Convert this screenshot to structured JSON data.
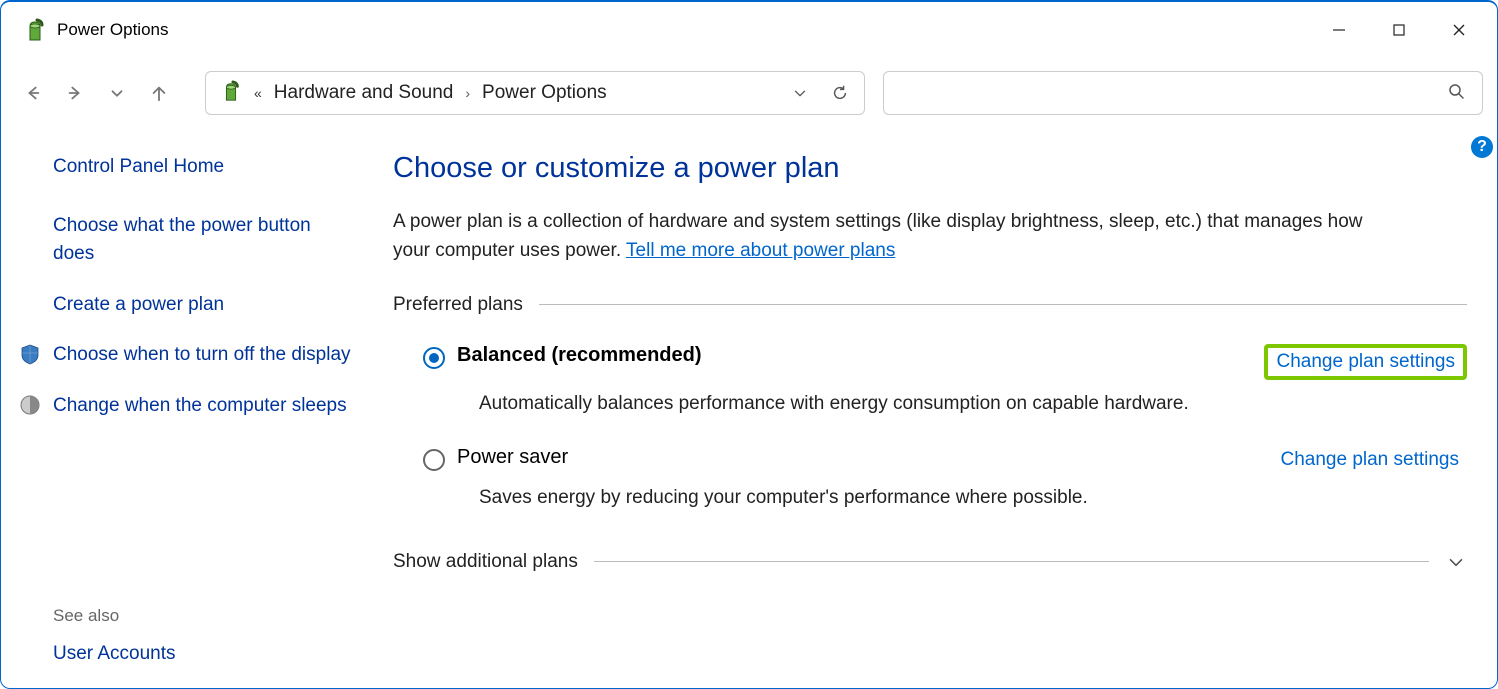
{
  "window": {
    "title": "Power Options"
  },
  "breadcrumb": {
    "item1": "Hardware and Sound",
    "item2": "Power Options"
  },
  "sidebar": {
    "home": "Control Panel Home",
    "tasks": [
      {
        "label": "Choose what the power button does"
      },
      {
        "label": "Create a power plan"
      },
      {
        "label": "Choose when to turn off the display"
      },
      {
        "label": "Change when the computer sleeps"
      }
    ],
    "see_also_label": "See also",
    "see_also_items": [
      {
        "label": "User Accounts"
      }
    ]
  },
  "main": {
    "heading": "Choose or customize a power plan",
    "description_pre": "A power plan is a collection of hardware and system settings (like display brightness, sleep, etc.) that manages how your computer uses power. ",
    "description_link": "Tell me more about power plans",
    "preferred_label": "Preferred plans",
    "additional_label": "Show additional plans",
    "plans": [
      {
        "name": "Balanced (recommended)",
        "desc": "Automatically balances performance with energy consumption on capable hardware.",
        "change": "Change plan settings"
      },
      {
        "name": "Power saver",
        "desc": "Saves energy by reducing your computer's performance where possible.",
        "change": "Change plan settings"
      }
    ],
    "help": "?"
  }
}
